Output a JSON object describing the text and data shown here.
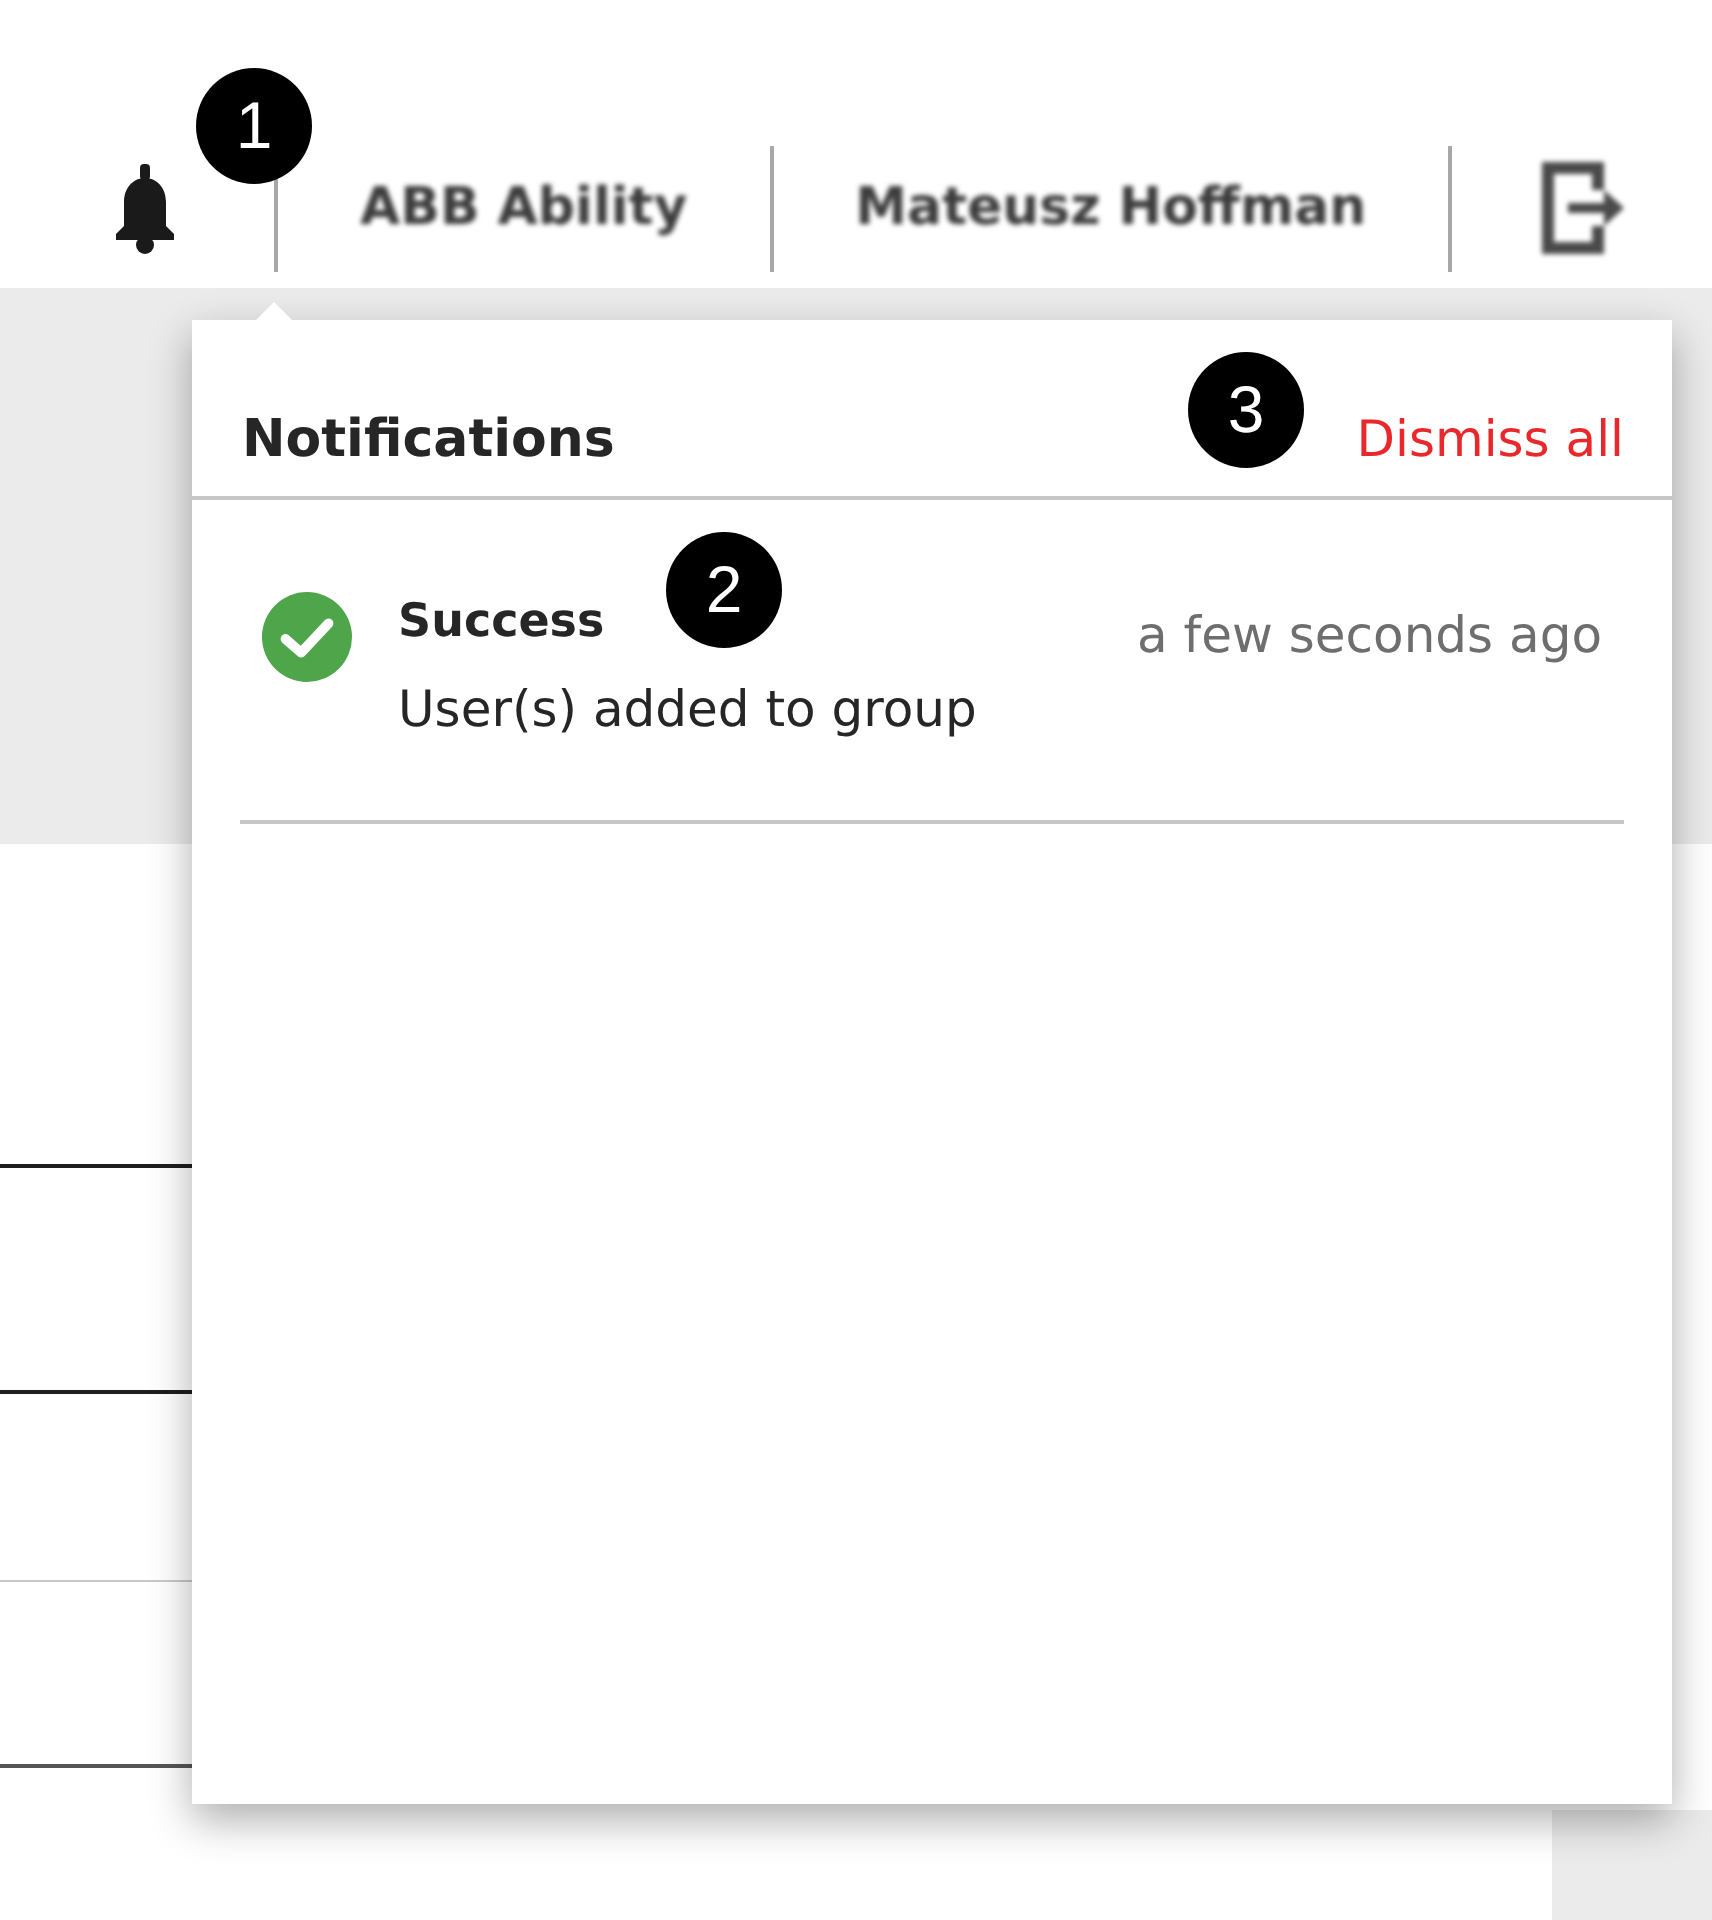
{
  "header": {
    "notifications_button": {
      "callout": "1"
    },
    "app_name": "ABB Ability",
    "user_name": "Mateusz Hoffman"
  },
  "notifications_panel": {
    "title": "Notifications",
    "dismiss_all": {
      "label": "Dismiss all",
      "callout": "3"
    },
    "items": [
      {
        "kind": "success",
        "title": "Success",
        "message": "User(s) added to group",
        "time": "a few seconds ago",
        "callout": "2"
      }
    ]
  }
}
